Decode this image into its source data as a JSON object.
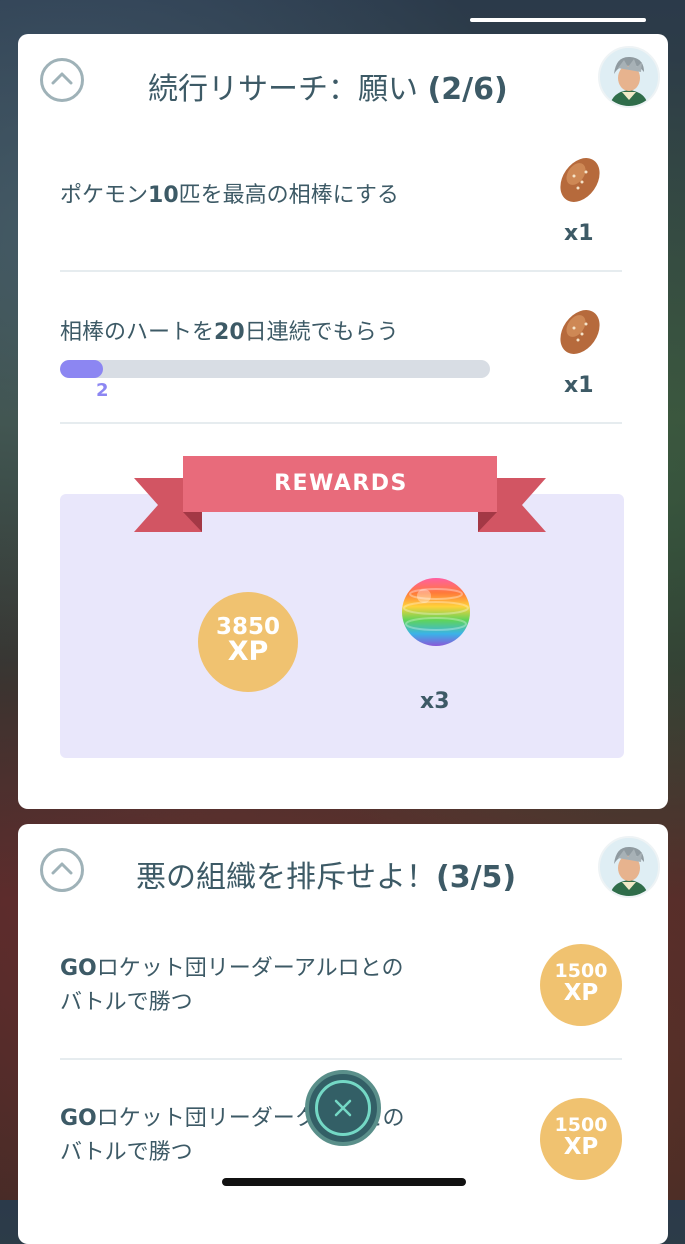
{
  "colors": {
    "accent_purple": "#8c86f2",
    "ribbon_pink": "#e86b7b",
    "xp_gold": "#f0c270",
    "text_dark": "#3d5a66",
    "rewards_bg": "#e9e7fb"
  },
  "research_1": {
    "title": "続行リサーチ：願い",
    "counter": "(2/6)",
    "tasks": [
      {
        "text_prefix": "ポケモン",
        "text_bold": "10",
        "text_suffix": "匹を最高の相棒にする",
        "reward_icon": "nanab-berry-icon",
        "reward_qty": "x1"
      },
      {
        "text_prefix": "相棒のハートを",
        "text_bold": "20",
        "text_suffix": "日連続でもらう",
        "reward_icon": "nanab-berry-icon",
        "reward_qty": "x1",
        "progress_label": "2",
        "progress_fraction": 0.1
      }
    ],
    "rewards": {
      "label": "REWARDS",
      "xp_amount": "3850",
      "xp_unit": "XP",
      "item_icon": "rainbow-stardust-ball-icon",
      "item_qty": "x3"
    }
  },
  "research_2": {
    "title": "悪の組織を排斥せよ！",
    "counter": "(3/5)",
    "tasks": [
      {
        "line1_bold": "GO",
        "line1_rest": "ロケット団リーダーアルロとの",
        "line2": "バトルで勝つ",
        "xp_amount": "1500",
        "xp_unit": "XP"
      },
      {
        "line1_bold": "GO",
        "line1_rest": "ロケット団リーダークリフとの",
        "line2": "バトルで勝つ",
        "xp_amount": "1500",
        "xp_unit": "XP"
      }
    ]
  }
}
